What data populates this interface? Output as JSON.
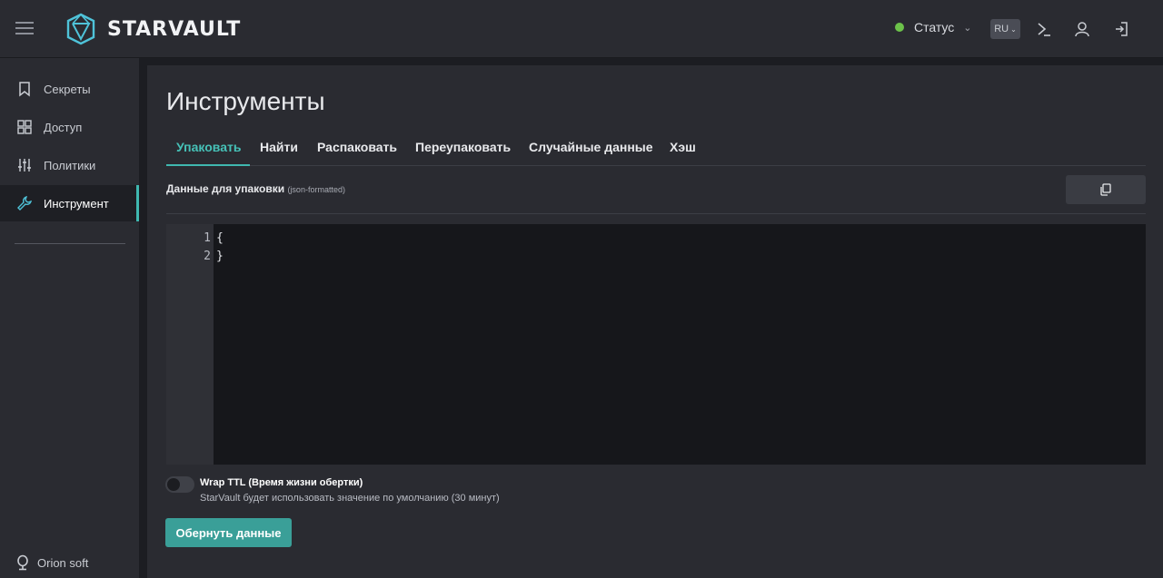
{
  "header": {
    "brand": "STARVAULT",
    "status_label": "Статус",
    "status_color": "#6cc24a",
    "language": "RU",
    "icons": [
      "menu-icon",
      "terminal-icon",
      "user-icon",
      "logout-icon"
    ]
  },
  "sidebar": {
    "items": [
      {
        "label": "Секреты",
        "icon": "bookmark-icon"
      },
      {
        "label": "Доступ",
        "icon": "grid-icon"
      },
      {
        "label": "Политики",
        "icon": "sliders-icon"
      },
      {
        "label": "Инструмент",
        "icon": "wrench-icon",
        "active": true
      }
    ],
    "footer_label": "Orion soft"
  },
  "main": {
    "title": "Инструменты",
    "tabs": [
      {
        "label": "Упаковать",
        "active": true
      },
      {
        "label": "Найти"
      },
      {
        "label": "Распаковать"
      },
      {
        "label": "Переупаковать"
      },
      {
        "label": "Случайные данные"
      },
      {
        "label": "Хэш"
      }
    ],
    "field_label": "Данные для упаковки",
    "field_hint": "(json-formatted)",
    "editor": {
      "line_numbers": [
        "1",
        "2"
      ],
      "lines": [
        "{",
        "}"
      ]
    },
    "wrap_ttl": {
      "title": "Wrap TTL (Время жизни обертки)",
      "help": "StarVault будет использовать значение по умолчанию (30 минут)",
      "enabled": false
    },
    "submit_label": "Обернуть данные"
  },
  "colors": {
    "accent": "#3fb8b0",
    "button": "#3a9f98",
    "background": "#1c1d22",
    "panel": "#2a2b31"
  }
}
